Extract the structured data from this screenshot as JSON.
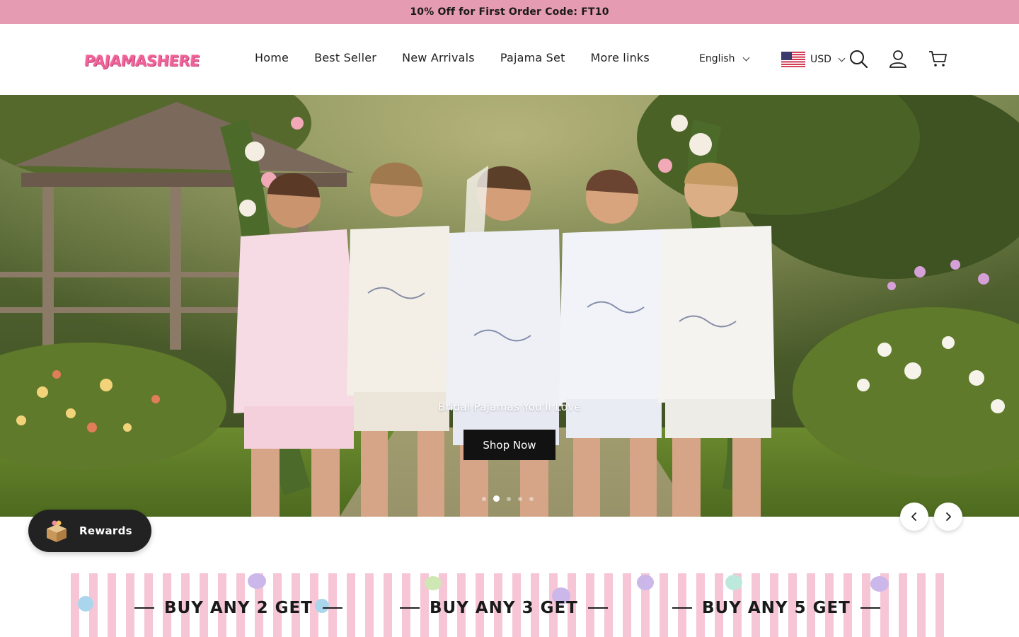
{
  "announcement": {
    "text": "10% Off for First Order Code: FT10"
  },
  "header": {
    "logo_text": "PAJAMASHERE",
    "nav": [
      {
        "label": "Home"
      },
      {
        "label": "Best Seller"
      },
      {
        "label": "New Arrivals"
      },
      {
        "label": "Pajama Set"
      },
      {
        "label": "More links"
      }
    ],
    "language": "English",
    "currency": "USD",
    "icons": [
      "search-icon",
      "account-icon",
      "cart-icon"
    ]
  },
  "hero": {
    "caption": "Bridal Pajamas You'll Love",
    "button_label": "Shop Now",
    "slides_count": 5,
    "active_slide": 2
  },
  "rewards": {
    "label": "Rewards"
  },
  "promo": {
    "items": [
      {
        "label": "BUY ANY 2 GET"
      },
      {
        "label": "BUY ANY 3 GET"
      },
      {
        "label": "BUY ANY 5 GET"
      }
    ]
  },
  "colors": {
    "announcement_bg": "#e59bb2",
    "logo_pink": "#f0639a",
    "button_dark": "#121212",
    "rewards_bg": "#222222"
  }
}
